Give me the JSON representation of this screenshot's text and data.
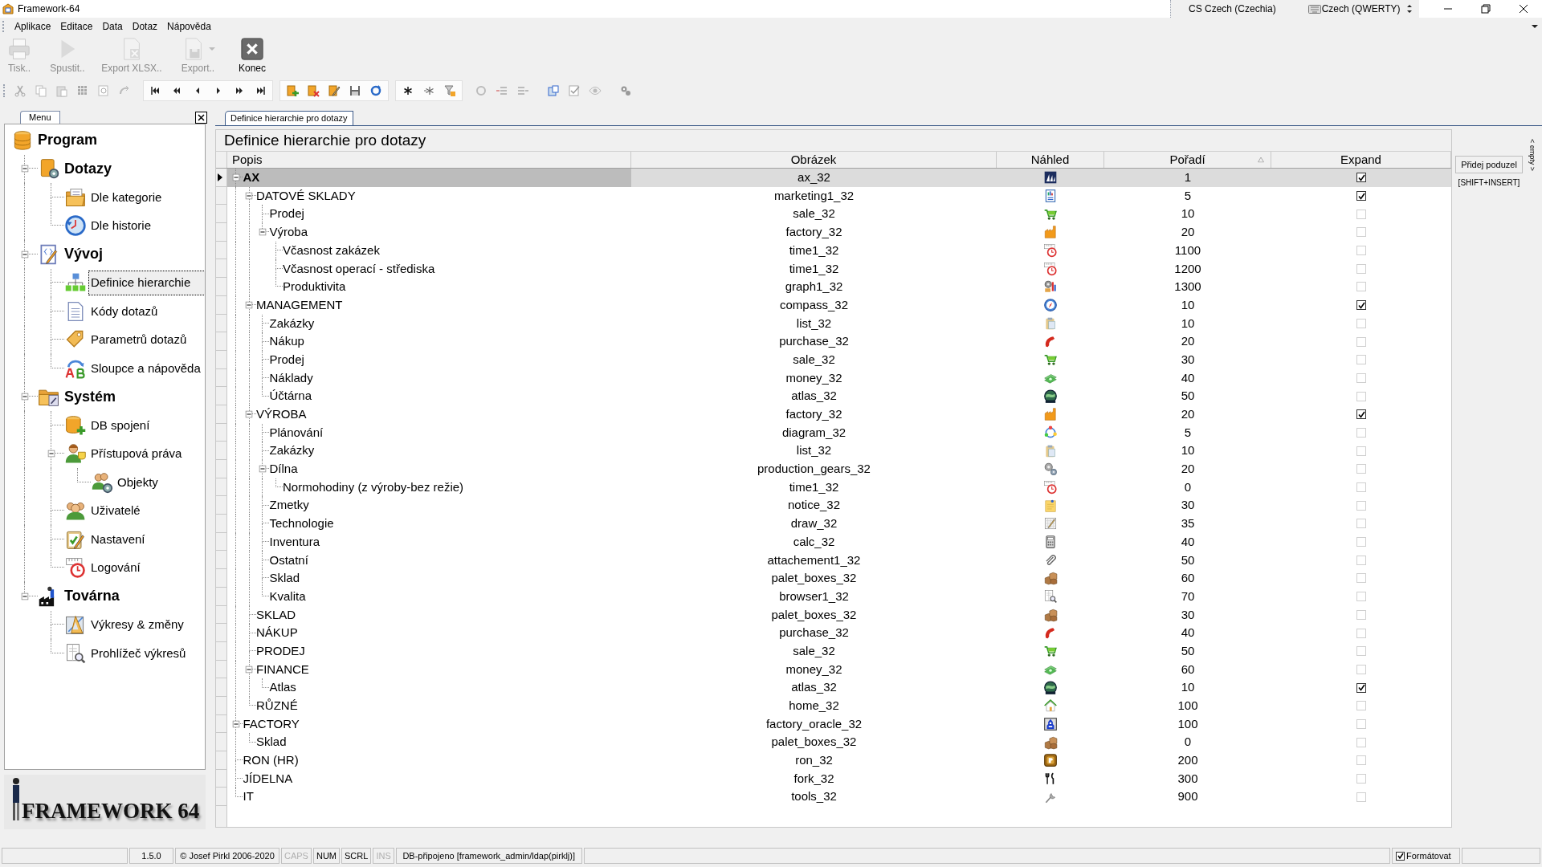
{
  "window": {
    "title": "Framework-64",
    "language": "CS Czech (Czechia)",
    "keyboard": "Czech (QWERTY)"
  },
  "menu_bar": [
    "Aplikace",
    "Editace",
    "Data",
    "Dotaz",
    "Nápověda"
  ],
  "toolbar": [
    {
      "label": "Tisk..",
      "kind": "printer",
      "disabled": true
    },
    {
      "label": "Spustit..",
      "kind": "play",
      "disabled": true
    },
    {
      "label": "Export XLSX..",
      "kind": "export-xlsx",
      "disabled": true
    },
    {
      "label": "Export..",
      "kind": "export",
      "disabled": true
    },
    {
      "label": "Konec",
      "kind": "close",
      "disabled": false
    }
  ],
  "side_panel": {
    "tab": "Menu",
    "tree": [
      {
        "label": "Program",
        "kind": "database",
        "selected": false,
        "children": [
          {
            "label": "Dotazy",
            "kind": "gear-box",
            "selected": false,
            "children": [
              {
                "label": "Dle kategorie",
                "kind": "folder-document",
                "selected": false
              },
              {
                "label": "Dle historie",
                "kind": "history-clock",
                "selected": false
              }
            ]
          },
          {
            "label": "Vývoj",
            "kind": "code-document",
            "selected": false,
            "children": [
              {
                "label": "Definice hierarchie",
                "kind": "hierarchy",
                "selected": true
              },
              {
                "label": "Kódy dotazů",
                "kind": "document",
                "selected": false
              },
              {
                "label": "Parametrů dotazů",
                "kind": "tag",
                "selected": false
              },
              {
                "label": "Sloupce a nápověda",
                "kind": "ab-arrow",
                "selected": false
              }
            ]
          },
          {
            "label": "Systém",
            "kind": "folder-wrench",
            "selected": false,
            "children": [
              {
                "label": "DB spojení",
                "kind": "database-plus",
                "selected": false
              },
              {
                "label": "Přístupová práva",
                "kind": "user-mask",
                "selected": false,
                "children": [
                  {
                    "label": "Objekty",
                    "kind": "users-gear",
                    "selected": false
                  }
                ]
              },
              {
                "label": "Uživatelé",
                "kind": "users",
                "selected": false
              },
              {
                "label": "Nastavení",
                "kind": "clipboard-check",
                "selected": false
              },
              {
                "label": "Logování",
                "kind": "clock",
                "selected": false
              }
            ]
          },
          {
            "label": "Továrna",
            "kind": "factory-smoke",
            "selected": false,
            "children": [
              {
                "label": "Výkresy & změny",
                "kind": "drawing-triangle",
                "selected": false
              },
              {
                "label": "Prohlížeč výkresů",
                "kind": "magnifier-document",
                "selected": false
              }
            ]
          }
        ]
      }
    ],
    "logo": "FRAMEWORK 64"
  },
  "document_tab": "Definice hierarchie pro dotazy",
  "panel_title": "Definice hierarchie pro dotazy",
  "table": {
    "columns": [
      "Popis",
      "Obrázek",
      "Náhled",
      "Pořadí",
      "Expand"
    ],
    "rows": [
      {
        "popis": "AX",
        "obrazek": "ax_32",
        "kind": "sailboats",
        "poradi": "1",
        "expand": true,
        "selected": true,
        "children": [
          {
            "popis": "DATOVÉ SKLADY",
            "obrazek": "marketing1_32",
            "kind": "report",
            "poradi": "5",
            "expand": true,
            "selected": false,
            "children": [
              {
                "popis": "Prodej",
                "obrazek": "sale_32",
                "kind": "cart",
                "poradi": "10",
                "expand": false,
                "selected": false
              },
              {
                "popis": "Výroba",
                "obrazek": "factory_32",
                "kind": "factory",
                "poradi": "20",
                "expand": false,
                "selected": false,
                "children": [
                  {
                    "popis": "Včasnost zakázek",
                    "obrazek": "time1_32",
                    "kind": "clock",
                    "poradi": "1100",
                    "expand": false,
                    "selected": false
                  },
                  {
                    "popis": "Včasnost operací - střediska",
                    "obrazek": "time1_32",
                    "kind": "clock",
                    "poradi": "1200",
                    "expand": false,
                    "selected": false
                  },
                  {
                    "popis": "Produktivita",
                    "obrazek": "graph1_32",
                    "kind": "gears-chart",
                    "poradi": "1300",
                    "expand": false,
                    "selected": false
                  }
                ]
              }
            ]
          },
          {
            "popis": "MANAGEMENT",
            "obrazek": "compass_32",
            "kind": "compass",
            "poradi": "10",
            "expand": true,
            "selected": false,
            "children": [
              {
                "popis": "Zakázky",
                "obrazek": "list_32",
                "kind": "clipboard",
                "poradi": "10",
                "expand": false,
                "selected": false
              },
              {
                "popis": "Nákup",
                "obrazek": "purchase_32",
                "kind": "phone",
                "poradi": "20",
                "expand": false,
                "selected": false
              },
              {
                "popis": "Prodej",
                "obrazek": "sale_32",
                "kind": "cart",
                "poradi": "30",
                "expand": false,
                "selected": false
              },
              {
                "popis": "Náklady",
                "obrazek": "money_32",
                "kind": "money",
                "poradi": "40",
                "expand": false,
                "selected": false
              },
              {
                "popis": "Účtárna",
                "obrazek": "atlas_32",
                "kind": "globe",
                "poradi": "50",
                "expand": false,
                "selected": false
              }
            ]
          },
          {
            "popis": "VÝROBA",
            "obrazek": "factory_32",
            "kind": "factory",
            "poradi": "20",
            "expand": true,
            "selected": false,
            "children": [
              {
                "popis": "Plánování",
                "obrazek": "diagram_32",
                "kind": "cycle",
                "poradi": "5",
                "expand": false,
                "selected": false
              },
              {
                "popis": "Zakázky",
                "obrazek": "list_32",
                "kind": "clipboard",
                "poradi": "10",
                "expand": false,
                "selected": false
              },
              {
                "popis": "Dílna",
                "obrazek": "production_gears_32",
                "kind": "gears",
                "poradi": "20",
                "expand": false,
                "selected": false,
                "children": [
                  {
                    "popis": "Normohodiny (z výroby-bez režie)",
                    "obrazek": "time1_32",
                    "kind": "clock",
                    "poradi": "0",
                    "expand": false,
                    "selected": false
                  }
                ]
              },
              {
                "popis": "Zmetky",
                "obrazek": "notice_32",
                "kind": "note",
                "poradi": "30",
                "expand": false,
                "selected": false
              },
              {
                "popis": "Technologie",
                "obrazek": "draw_32",
                "kind": "pencil-grid",
                "poradi": "35",
                "expand": false,
                "selected": false
              },
              {
                "popis": "Inventura",
                "obrazek": "calc_32",
                "kind": "calculator",
                "poradi": "40",
                "expand": false,
                "selected": false
              },
              {
                "popis": "Ostatní",
                "obrazek": "attachement1_32",
                "kind": "paperclip",
                "poradi": "50",
                "expand": false,
                "selected": false
              },
              {
                "popis": "Sklad",
                "obrazek": "palet_boxes_32",
                "kind": "boxes",
                "poradi": "60",
                "expand": false,
                "selected": false
              },
              {
                "popis": "Kvalita",
                "obrazek": "browser1_32",
                "kind": "magnifier-document",
                "poradi": "70",
                "expand": false,
                "selected": false
              }
            ]
          },
          {
            "popis": "SKLAD",
            "obrazek": "palet_boxes_32",
            "kind": "boxes",
            "poradi": "30",
            "expand": false,
            "selected": false
          },
          {
            "popis": "NÁKUP",
            "obrazek": "purchase_32",
            "kind": "phone",
            "poradi": "40",
            "expand": false,
            "selected": false
          },
          {
            "popis": "PRODEJ",
            "obrazek": "sale_32",
            "kind": "cart",
            "poradi": "50",
            "expand": false,
            "selected": false
          },
          {
            "popis": "FINANCE",
            "obrazek": "money_32",
            "kind": "money",
            "poradi": "60",
            "expand": false,
            "selected": false,
            "children": [
              {
                "popis": "Atlas",
                "obrazek": "atlas_32",
                "kind": "globe",
                "poradi": "10",
                "expand": true,
                "selected": false
              }
            ]
          },
          {
            "popis": "RŮZNÉ",
            "obrazek": "home_32",
            "kind": "house",
            "poradi": "100",
            "expand": false,
            "selected": false
          }
        ]
      },
      {
        "popis": "FACTORY",
        "obrazek": "factory_oracle_32",
        "kind": "tower",
        "poradi": "100",
        "expand": false,
        "selected": false,
        "children": [
          {
            "popis": "Sklad",
            "obrazek": "palet_boxes_32",
            "kind": "boxes",
            "poradi": "0",
            "expand": false,
            "selected": false
          }
        ]
      },
      {
        "popis": "RON (HR)",
        "obrazek": "ron_32",
        "kind": "tile",
        "poradi": "200",
        "expand": false,
        "selected": false
      },
      {
        "popis": "JÍDELNA",
        "obrazek": "fork_32",
        "kind": "cutlery",
        "poradi": "300",
        "expand": false,
        "selected": false
      },
      {
        "popis": "IT",
        "obrazek": "tools_32",
        "kind": "wrench",
        "poradi": "900",
        "expand": false,
        "selected": false
      }
    ]
  },
  "add_button": {
    "label": "Přidej poduzel",
    "shortcut": "[SHIFT+INSERT]"
  },
  "side_strip": "< empty >",
  "status_bar": {
    "version": "1.5.0",
    "copyright": "© Josef Pirkl 2006-2020",
    "indicators": [
      {
        "label": "CAPS",
        "on": false
      },
      {
        "label": "NUM",
        "on": true
      },
      {
        "label": "SCRL",
        "on": true
      },
      {
        "label": "INS",
        "on": false
      }
    ],
    "connection": "DB-připojeno [framework_admin/ldap(pirklj)]",
    "format": {
      "label": "Formátovat",
      "checked": true
    }
  }
}
